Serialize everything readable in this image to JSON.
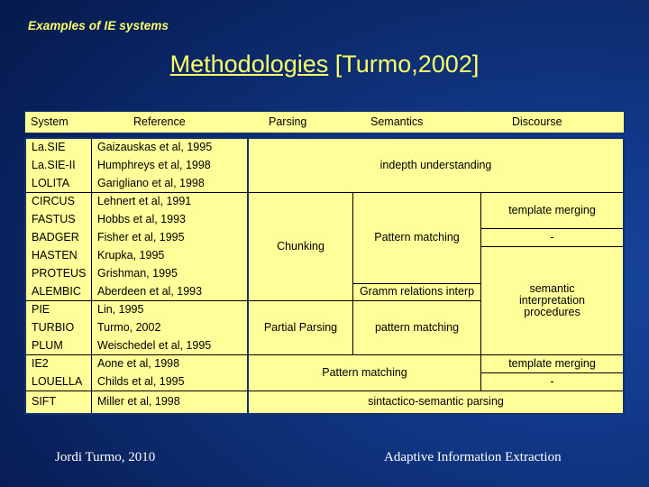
{
  "slide": {
    "eyebrow": "Examples of IE systems",
    "title_underlined": "Methodologies",
    "title_rest": " [Turmo,2002]",
    "colors": {
      "background_blue": "#123a8c",
      "accent_yellow": "#ffff66",
      "table_fill": "#ffff99",
      "table_border": "#13306e",
      "text_black": "#000000",
      "footer_white": "#ffffff"
    }
  },
  "table": {
    "headers": {
      "system": "System",
      "reference": "Reference",
      "parsing": "Parsing",
      "semantics": "Semantics",
      "discourse": "Discourse"
    },
    "rows": [
      {
        "system": "La.SIE",
        "reference": "Gaizauskas et al, 1995"
      },
      {
        "system": "La.SIE-II",
        "reference": "Humphreys et al, 1998"
      },
      {
        "system": "LOLITA",
        "reference": "Garigliano et al, 1998"
      },
      {
        "system": "CIRCUS",
        "reference": "Lehnert et al, 1991"
      },
      {
        "system": "FASTUS",
        "reference": "Hobbs et al, 1993"
      },
      {
        "system": "BADGER",
        "reference": "Fisher et al, 1995"
      },
      {
        "system": "HASTEN",
        "reference": "Krupka, 1995"
      },
      {
        "system": "PROTEUS",
        "reference": "Grishman, 1995"
      },
      {
        "system": "ALEMBIC",
        "reference": "Aberdeen et al, 1993"
      },
      {
        "system": "PIE",
        "reference": "Lin, 1995"
      },
      {
        "system": "TURBIO",
        "reference": "Turmo, 2002"
      },
      {
        "system": "PLUM",
        "reference": "Weischedel et al, 1995"
      },
      {
        "system": "IE2",
        "reference": "Aone et al, 1998"
      },
      {
        "system": "LOUELLA",
        "reference": "Childs et al, 1995"
      },
      {
        "system": "SIFT",
        "reference": "Miller et al, 1998"
      }
    ],
    "merged": {
      "indepth_understanding": "indepth understanding",
      "chunking": "Chunking",
      "pattern_matching_upper": "Pattern matching",
      "gramm_relations_interp": "Gramm relations interp",
      "partial_parsing": "Partial Parsing",
      "pattern_matching_lower": "pattern matching",
      "pattern_matching_ie2": "Pattern matching",
      "sintactico_semantic_parsing": "sintactico-semantic parsing",
      "template_merging_1": "template merging",
      "dash_1": "-",
      "semantic_interp_l1": "semantic",
      "semantic_interp_l2": "interpretation",
      "semantic_interp_l3": "procedures",
      "template_merging_2": "template merging",
      "dash_2": "-"
    }
  },
  "footer": {
    "left": "Jordi Turmo, 2010",
    "right": "Adaptive Information Extraction"
  }
}
